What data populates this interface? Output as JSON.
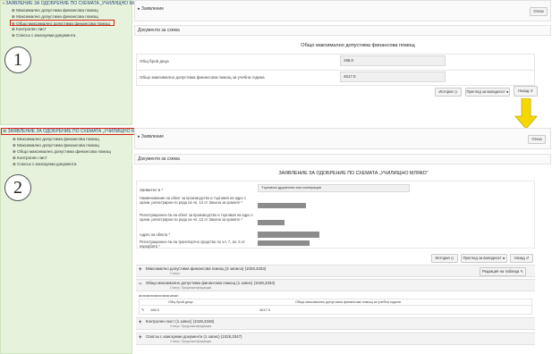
{
  "tree1": {
    "root": "ЗАЯВЛЕНИЕ ЗА ОДОБРЕНИЕ ПО СХЕМАТА „УЧИЛИЩНО МЛЯКО“",
    "items": [
      "Максимално допустима финансова помощ",
      "Максимално допустима финансова помощ",
      "Общо максимално допустима финансова помощ",
      "Контролен лист",
      "Списък с изискуеми документа"
    ]
  },
  "tree2": {
    "root": "ЗАЯВЛЕНИЕ ЗА ОДОБРЕНИЕ ПО СХЕМАТА „УЧИЛИЩНО МЛЯКО“",
    "items": [
      "Максимално допустима финансова помощ",
      "Максимално допустима финансова помощ",
      "Общо максимално допустима финансова помощ",
      "Контролен лист",
      "Списък с изискуеми документи"
    ]
  },
  "markers": {
    "one": "1",
    "two": "2"
  },
  "top": {
    "header": "Заявление",
    "close": "Отказ",
    "section": "Документи за схема",
    "title": "Общо максимално допустима финансова помощ",
    "field1_label": "Общ брой деца",
    "field1_value": "196.0",
    "field2_label": "Общо максимално допустима финансова помощ за учебна година",
    "field2_value": "4617.0",
    "btn_history": "История",
    "btn_validity": "Преглед за валидност",
    "btn_back": "Назад"
  },
  "bottom": {
    "header": "Заявление",
    "close": "Отказ",
    "section": "Документи за схема",
    "title": "ЗАЯВЛЕНИЕ ЗА ОДОБРЕНИЕ ПО СХЕМАТА „УЧИЛИЩНО МЛЯКО“",
    "applicant_label": "Заявител в *",
    "applicant_value": "Търговско дружество или кооперация",
    "label2": "Наименование на обект за производство и търговия на едро с храни, регистриран по реда на чл. 12 от Закона за храните *",
    "label3": "Регистрационен № на обект за производство и търговия на едро с храни, регистриран по реда на чл. 12 от Закона за храните *",
    "label4": "Адрес на обекта *",
    "label5": "Регистрационен № на транспортно средство по чл. 7, ал. 6 от наредбата *",
    "btn_history": "История",
    "btn_validity": "Преглед за валидност",
    "btn_back": "Назад",
    "sect1_title": "Максимално допустима финансова помощ (2 записа) (1028,3333)",
    "sect1_sub": "Статус:",
    "sect1_btn": "Редакция на таблица",
    "sect2_title": "Общо максимално допустима финансова помощ (1 запис) (1028,3334)",
    "sect2_sub": "Статус: Предложен/редакция",
    "noise": "anananananananananan",
    "table_headers": [
      "Общ брой деца",
      "Обща максимално допустима финансова помощ за учебна година"
    ],
    "table_values": [
      "186.0",
      "4617.0"
    ],
    "sect3_title": "Контролен лист (1 запис) (1028,3348)",
    "sect3_sub": "Статус: Предложен/редакция",
    "sect4_title": "Списък с изискуеми документи (1 запис) (1028,3347)",
    "sect4_sub": "Статус: Предложен/редакция"
  },
  "colors": {
    "highlight": "#d9261c",
    "arrow": "#f5d800",
    "tree_bg": "#e6f2dc",
    "redacted": "#8c8c8c"
  }
}
